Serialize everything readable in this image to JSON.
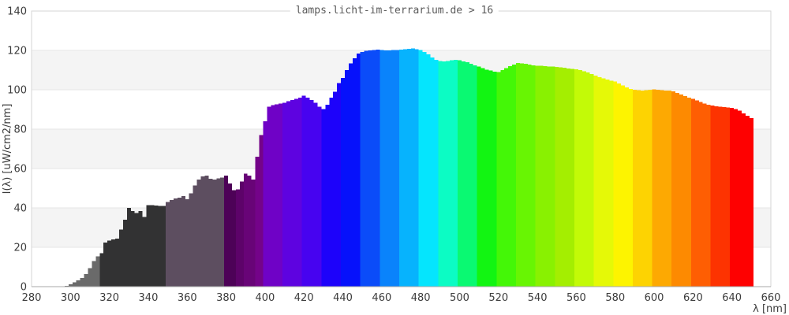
{
  "header": {
    "title": "lamps.licht-im-terrarium.de > 16"
  },
  "chart_data": {
    "type": "area",
    "title": "lamps.licht-im-terrarium.de > 16",
    "xlabel": "λ [nm]",
    "ylabel": "I(λ)  [uW/cm2/nm]",
    "xlim": [
      280,
      660
    ],
    "ylim": [
      0,
      140
    ],
    "x_ticks": [
      280,
      300,
      320,
      340,
      360,
      380,
      400,
      420,
      440,
      460,
      480,
      500,
      520,
      540,
      560,
      580,
      600,
      620,
      640,
      660
    ],
    "y_ticks": [
      0,
      20,
      40,
      60,
      80,
      100,
      120,
      140
    ],
    "grid": "horizontal",
    "legend": "none",
    "stripe_bands_y": [
      [
        20,
        40
      ],
      [
        60,
        80
      ],
      [
        100,
        120
      ]
    ],
    "colors": {
      "stripe": "#f4f4f4",
      "grid": "#e6e6e6",
      "frame": "#d6d6d6",
      "axis": "#a8a8a8",
      "label": "#3c3c3c",
      "title": "#5a5a5a",
      "background": "#ffffff"
    },
    "color_bands": [
      [
        294,
        315,
        "#6a6a6a"
      ],
      [
        315,
        350,
        "#323233"
      ],
      [
        350,
        380,
        "#5d4e60"
      ],
      [
        380,
        385,
        "#4d0257"
      ],
      [
        385,
        390,
        "#5d0369"
      ],
      [
        390,
        395,
        "#680477"
      ],
      [
        395,
        400,
        "#740389"
      ],
      [
        400,
        410,
        "#6f02c6"
      ],
      [
        410,
        420,
        "#5e03e0"
      ],
      [
        420,
        430,
        "#4703f0"
      ],
      [
        430,
        440,
        "#1d02fa"
      ],
      [
        440,
        450,
        "#0611fb"
      ],
      [
        450,
        460,
        "#0b4cf9"
      ],
      [
        460,
        470,
        "#0a83fb"
      ],
      [
        470,
        480,
        "#07b3fd"
      ],
      [
        480,
        490,
        "#05e5fd"
      ],
      [
        490,
        500,
        "#0cfcc4"
      ],
      [
        500,
        510,
        "#0af972"
      ],
      [
        510,
        520,
        "#12f512"
      ],
      [
        520,
        530,
        "#44f707"
      ],
      [
        530,
        540,
        "#68f503"
      ],
      [
        540,
        550,
        "#89f101"
      ],
      [
        550,
        560,
        "#a4ee01"
      ],
      [
        560,
        570,
        "#c3fa07"
      ],
      [
        570,
        580,
        "#e5f907"
      ],
      [
        580,
        590,
        "#fdf400"
      ],
      [
        590,
        600,
        "#fdd302"
      ],
      [
        600,
        610,
        "#fda902"
      ],
      [
        610,
        620,
        "#fd8a01"
      ],
      [
        620,
        630,
        "#fe5e03"
      ],
      [
        630,
        640,
        "#fd3301"
      ],
      [
        640,
        652,
        "#fe0101"
      ]
    ],
    "points": [
      [
        294,
        0
      ],
      [
        296,
        0.2
      ],
      [
        298,
        0.5
      ],
      [
        300,
        1.2
      ],
      [
        302,
        2.2
      ],
      [
        304,
        3.2
      ],
      [
        306,
        4.5
      ],
      [
        308,
        6.5
      ],
      [
        310,
        9.5
      ],
      [
        312,
        13
      ],
      [
        314,
        15.5
      ],
      [
        316,
        17
      ],
      [
        318,
        22.5
      ],
      [
        320,
        23.5
      ],
      [
        322,
        24
      ],
      [
        324,
        24.5
      ],
      [
        326,
        29
      ],
      [
        328,
        34
      ],
      [
        330,
        40
      ],
      [
        332,
        38.5
      ],
      [
        334,
        37.5
      ],
      [
        336,
        38.5
      ],
      [
        338,
        35.5
      ],
      [
        340,
        41.5
      ],
      [
        342,
        41.5
      ],
      [
        344,
        41.3
      ],
      [
        346,
        41
      ],
      [
        348,
        41
      ],
      [
        350,
        43
      ],
      [
        352,
        44
      ],
      [
        354,
        44.8
      ],
      [
        356,
        45.3
      ],
      [
        358,
        46
      ],
      [
        360,
        44.5
      ],
      [
        362,
        47.5
      ],
      [
        364,
        51.5
      ],
      [
        366,
        54.5
      ],
      [
        368,
        56
      ],
      [
        370,
        56.5
      ],
      [
        372,
        54.8
      ],
      [
        374,
        54.5
      ],
      [
        376,
        55
      ],
      [
        378,
        55.5
      ],
      [
        380,
        56.5
      ],
      [
        382,
        52.5
      ],
      [
        384,
        49
      ],
      [
        386,
        49.5
      ],
      [
        388,
        53.5
      ],
      [
        390,
        57.5
      ],
      [
        392,
        56.5
      ],
      [
        394,
        54.5
      ],
      [
        396,
        66
      ],
      [
        398,
        77
      ],
      [
        400,
        84
      ],
      [
        402,
        91.5
      ],
      [
        404,
        92.3
      ],
      [
        406,
        92.6
      ],
      [
        408,
        93
      ],
      [
        410,
        93.5
      ],
      [
        412,
        94.2
      ],
      [
        414,
        94.8
      ],
      [
        416,
        95.4
      ],
      [
        418,
        96
      ],
      [
        420,
        97
      ],
      [
        422,
        96
      ],
      [
        424,
        94.8
      ],
      [
        426,
        93.5
      ],
      [
        428,
        91.5
      ],
      [
        430,
        90.3
      ],
      [
        432,
        92.5
      ],
      [
        434,
        96
      ],
      [
        436,
        99
      ],
      [
        438,
        103.5
      ],
      [
        440,
        106
      ],
      [
        442,
        110
      ],
      [
        444,
        113.5
      ],
      [
        446,
        116
      ],
      [
        448,
        118.5
      ],
      [
        450,
        119.3
      ],
      [
        452,
        119.8
      ],
      [
        454,
        120
      ],
      [
        456,
        120.3
      ],
      [
        458,
        120.5
      ],
      [
        460,
        120.3
      ],
      [
        462,
        120
      ],
      [
        464,
        120
      ],
      [
        466,
        120.2
      ],
      [
        468,
        120.3
      ],
      [
        470,
        120.5
      ],
      [
        472,
        120.6
      ],
      [
        474,
        120.8
      ],
      [
        476,
        121
      ],
      [
        478,
        120.6
      ],
      [
        480,
        120.2
      ],
      [
        482,
        119.3
      ],
      [
        484,
        118
      ],
      [
        486,
        116.5
      ],
      [
        488,
        115.3
      ],
      [
        490,
        114.6
      ],
      [
        492,
        114.5
      ],
      [
        494,
        114.7
      ],
      [
        496,
        115
      ],
      [
        498,
        115.2
      ],
      [
        500,
        115
      ],
      [
        502,
        114.5
      ],
      [
        504,
        114
      ],
      [
        506,
        113.3
      ],
      [
        508,
        112.5
      ],
      [
        510,
        111.8
      ],
      [
        512,
        111
      ],
      [
        514,
        110.3
      ],
      [
        516,
        109.8
      ],
      [
        518,
        109.2
      ],
      [
        520,
        109
      ],
      [
        522,
        110
      ],
      [
        524,
        111
      ],
      [
        526,
        112
      ],
      [
        528,
        112.8
      ],
      [
        530,
        113.6
      ],
      [
        532,
        113.4
      ],
      [
        534,
        113.2
      ],
      [
        536,
        112.8
      ],
      [
        538,
        112.5
      ],
      [
        540,
        112.3
      ],
      [
        542,
        112.2
      ],
      [
        544,
        112
      ],
      [
        546,
        111.9
      ],
      [
        548,
        111.8
      ],
      [
        550,
        111.6
      ],
      [
        552,
        111.4
      ],
      [
        554,
        111.2
      ],
      [
        556,
        110.9
      ],
      [
        558,
        110.7
      ],
      [
        560,
        110.4
      ],
      [
        562,
        110
      ],
      [
        564,
        109.4
      ],
      [
        566,
        108.8
      ],
      [
        568,
        108
      ],
      [
        570,
        107.2
      ],
      [
        572,
        106.4
      ],
      [
        574,
        105.8
      ],
      [
        576,
        105.2
      ],
      [
        578,
        104.7
      ],
      [
        580,
        104.2
      ],
      [
        582,
        103.2
      ],
      [
        584,
        102.2
      ],
      [
        586,
        101.2
      ],
      [
        588,
        100.5
      ],
      [
        590,
        100.1
      ],
      [
        592,
        99.8
      ],
      [
        594,
        99.7
      ],
      [
        596,
        99.8
      ],
      [
        598,
        100
      ],
      [
        600,
        100.2
      ],
      [
        602,
        100
      ],
      [
        604,
        99.8
      ],
      [
        606,
        99.7
      ],
      [
        608,
        99.6
      ],
      [
        610,
        99.3
      ],
      [
        612,
        98.5
      ],
      [
        614,
        97.6
      ],
      [
        616,
        96.8
      ],
      [
        618,
        96.1
      ],
      [
        620,
        95.4
      ],
      [
        622,
        94.6
      ],
      [
        624,
        93.8
      ],
      [
        626,
        93
      ],
      [
        628,
        92.4
      ],
      [
        630,
        92
      ],
      [
        632,
        91.7
      ],
      [
        634,
        91.4
      ],
      [
        636,
        91.2
      ],
      [
        638,
        91
      ],
      [
        640,
        90.8
      ],
      [
        642,
        90.3
      ],
      [
        644,
        89.5
      ],
      [
        646,
        88
      ],
      [
        648,
        86.8
      ],
      [
        650,
        85.6
      ]
    ]
  }
}
